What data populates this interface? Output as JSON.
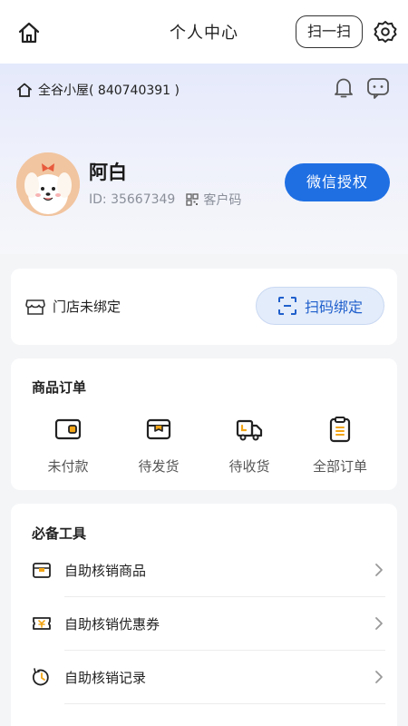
{
  "header": {
    "title": "个人中心",
    "scan_label": "扫一扫"
  },
  "store": {
    "name": "全谷小屋( 840740391 )"
  },
  "user": {
    "name": "阿白",
    "id_text": "ID: 35667349",
    "qr_label": "客户码",
    "wechat_label": "微信授权"
  },
  "bind": {
    "label": "门店未绑定",
    "button_label": "扫码绑定"
  },
  "orders": {
    "title": "商品订单",
    "items": [
      {
        "label": "未付款",
        "icon": "wallet-icon"
      },
      {
        "label": "待发货",
        "icon": "package-icon"
      },
      {
        "label": "待收货",
        "icon": "truck-icon"
      },
      {
        "label": "全部订单",
        "icon": "clipboard-icon"
      }
    ]
  },
  "tools": {
    "title": "必备工具",
    "items": [
      {
        "label": "自助核销商品",
        "icon": "goods-icon"
      },
      {
        "label": "自助核销优惠券",
        "icon": "coupon-icon"
      },
      {
        "label": "自助核销记录",
        "icon": "history-icon"
      }
    ]
  },
  "colors": {
    "accent": "#1f6fe3",
    "icon_accent": "#f2a516",
    "background": "#f4f5f7"
  }
}
